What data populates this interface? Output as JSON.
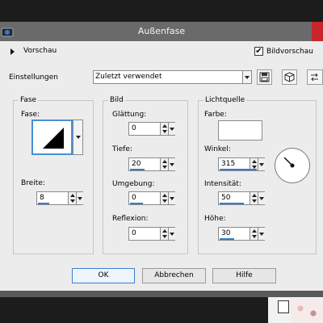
{
  "window": {
    "title": "Außenfase"
  },
  "preview": {
    "label": "Vorschau",
    "bild_checked": "✔",
    "bild_label": "Bildvorschau"
  },
  "settings": {
    "label": "Einstellungen",
    "value": "Zuletzt verwendet"
  },
  "fase": {
    "group_title": "Fase",
    "shape_label": "Fase:",
    "breite_label": "Breite:",
    "breite": "8"
  },
  "bild": {
    "group_title": "Bild",
    "glaettung_label": "Glättung:",
    "glaettung": "0",
    "tiefe_label": "Tiefe:",
    "tiefe": "20",
    "umgebung_label": "Umgebung:",
    "umgebung": "0",
    "reflexion_label": "Reflexion:",
    "reflexion": "0"
  },
  "licht": {
    "group_title": "Lichtquelle",
    "farbe_label": "Farbe:",
    "farbe_color": "#ffffff",
    "winkel_label": "Winkel:",
    "winkel": "315",
    "intensitaet_label": "Intensität:",
    "intensitaet": "50",
    "hoehe_label": "Höhe:",
    "hoehe": "30"
  },
  "buttons": {
    "ok": "OK",
    "abbrechen": "Abbrechen",
    "hilfe": "Hilfe"
  },
  "colors": {
    "accent": "#2f7fd0",
    "titlebar": "#6a6a6a",
    "dialog": "#ececec"
  },
  "icons": {
    "app": "app-icon",
    "save": "save-icon",
    "cube": "cube-icon",
    "swap": "swap-icon",
    "shape": "bevel-triangle-icon"
  }
}
